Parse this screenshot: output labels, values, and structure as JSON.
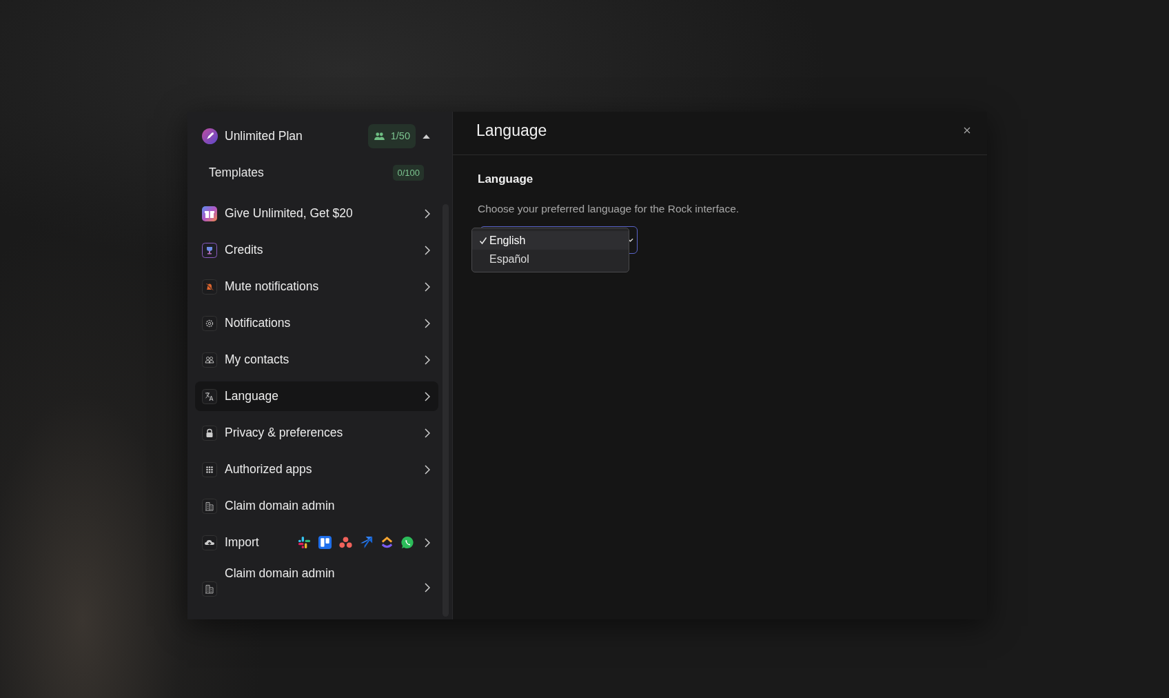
{
  "plan": {
    "title": "Unlimited Plan",
    "members": "1/50",
    "expanded": true
  },
  "templates": {
    "label": "Templates",
    "count": "0/100"
  },
  "menu": [
    {
      "label": "Give Unlimited, Get $20",
      "kind": "gift",
      "selected": false,
      "has_chevron": true
    },
    {
      "label": "Credits",
      "kind": "trophy",
      "selected": false,
      "has_chevron": true
    },
    {
      "label": "Mute notifications",
      "kind": "bell",
      "selected": false,
      "has_chevron": true
    },
    {
      "label": "Notifications",
      "kind": "gear",
      "selected": false,
      "has_chevron": true
    },
    {
      "label": "My contacts",
      "kind": "people",
      "selected": false,
      "has_chevron": true
    },
    {
      "label": "Language",
      "kind": "translate",
      "selected": true,
      "has_chevron": true
    },
    {
      "label": "Privacy & preferences",
      "kind": "lock",
      "selected": false,
      "has_chevron": true
    },
    {
      "label": "Authorized apps",
      "kind": "grid",
      "selected": false,
      "has_chevron": true
    },
    {
      "label": "Claim domain admin",
      "kind": "building",
      "selected": false,
      "has_chevron": false
    },
    {
      "label": "Import",
      "kind": "import",
      "selected": false,
      "has_chevron": true
    },
    {
      "label": "Claim domain admin",
      "kind": "building-tall",
      "selected": false,
      "has_chevron": true
    }
  ],
  "panel": {
    "title": "Language",
    "section": "Language",
    "description": "Choose your preferred language for the Rock interface.",
    "options": [
      {
        "label": "English",
        "selected": true
      },
      {
        "label": "Español",
        "selected": false
      }
    ]
  }
}
